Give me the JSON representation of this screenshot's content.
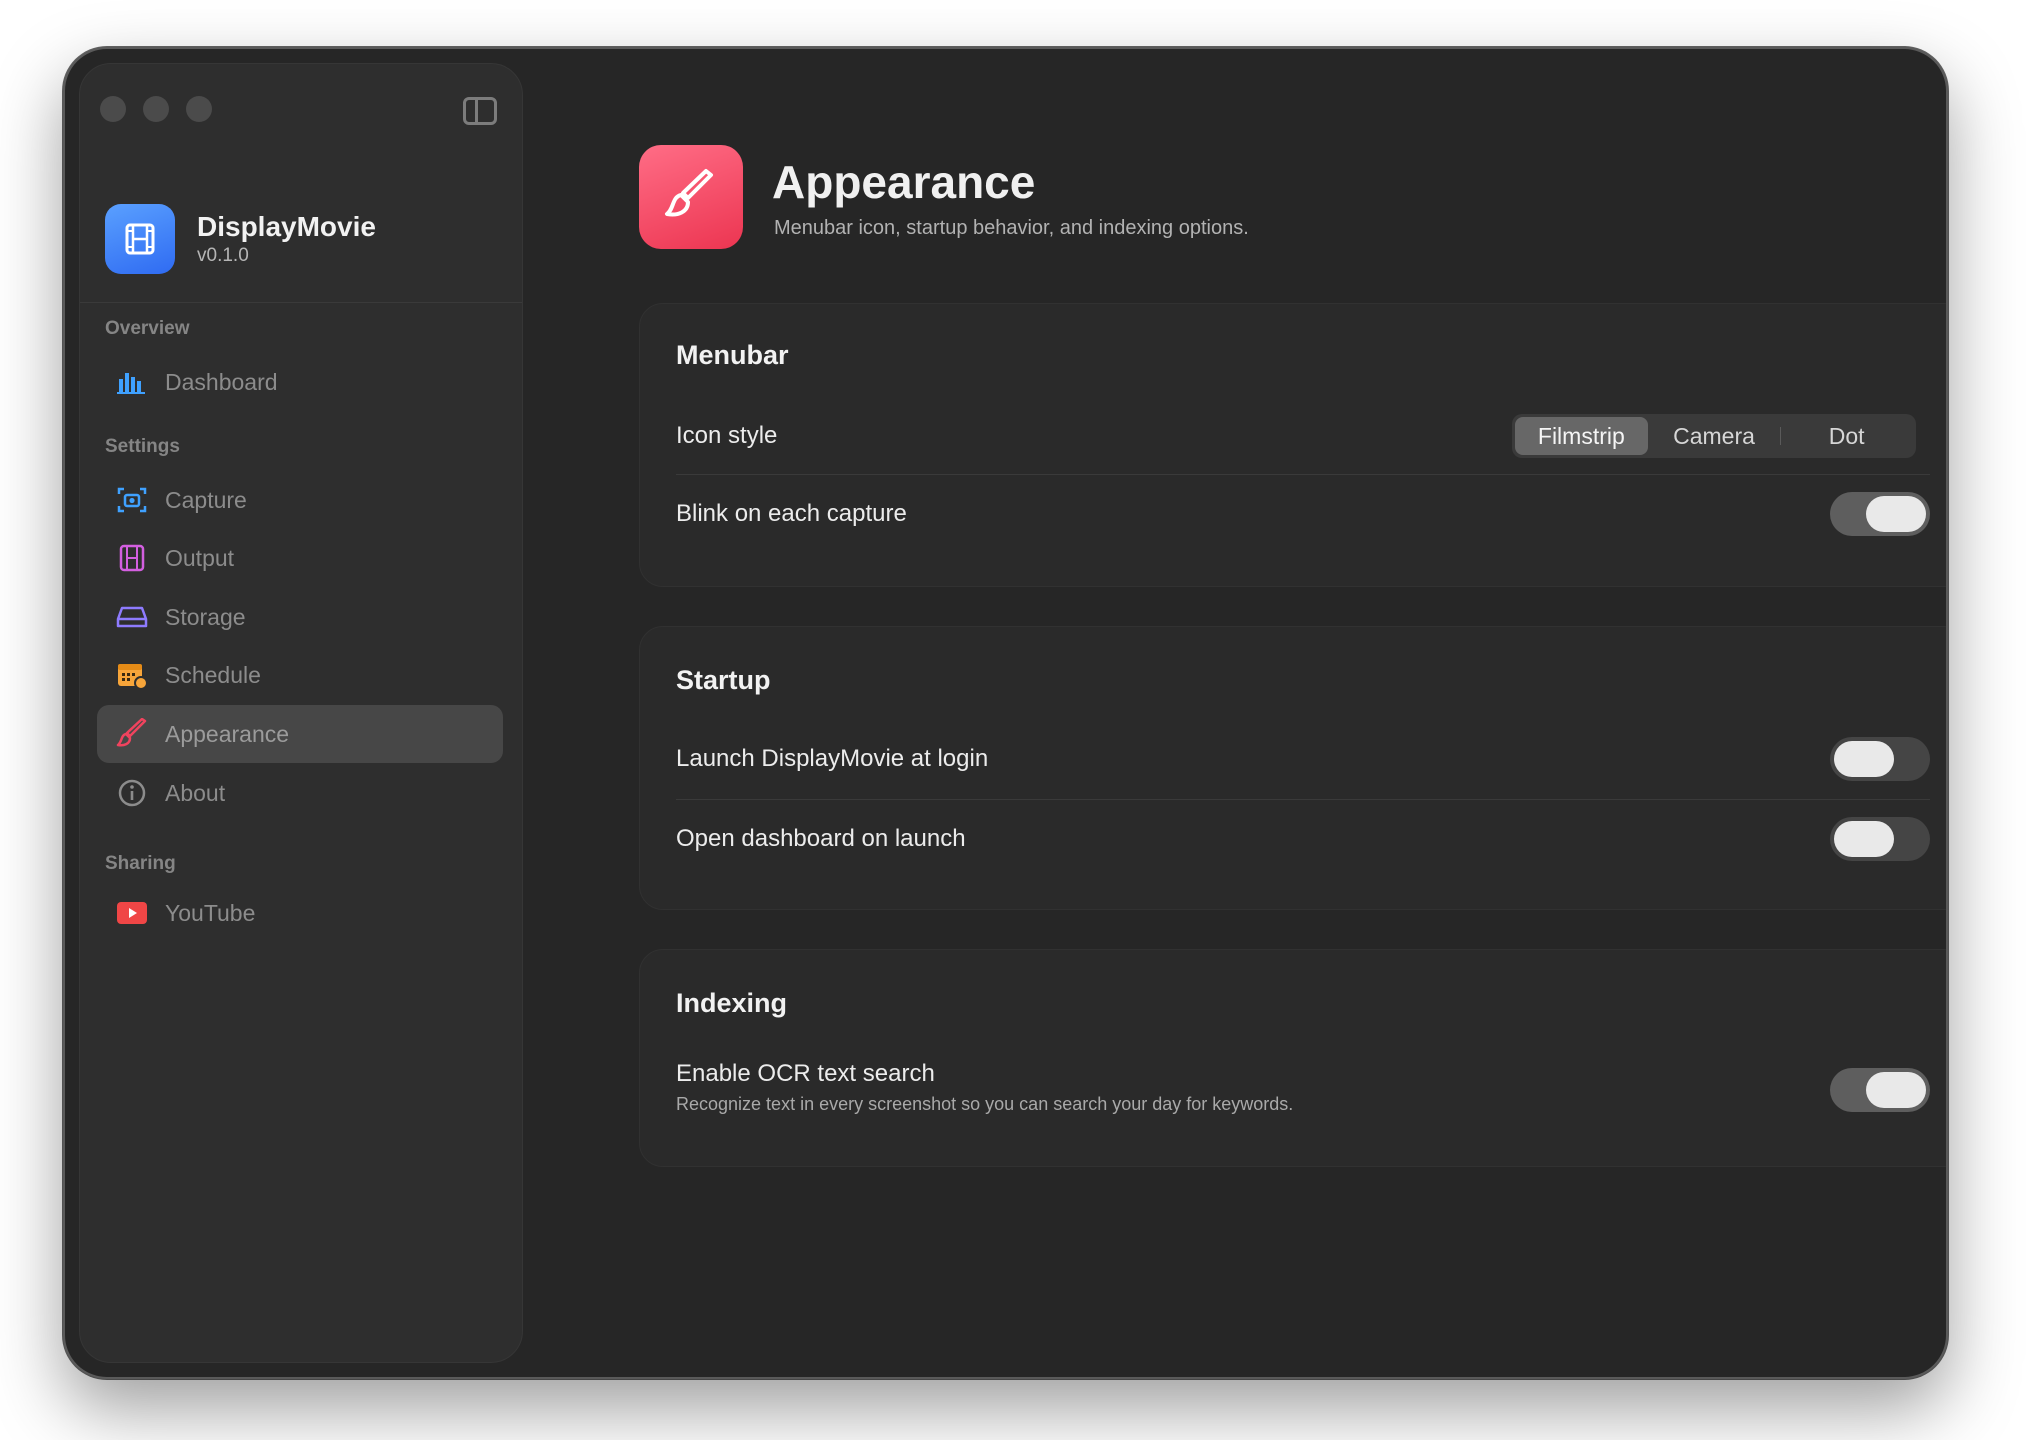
{
  "app": {
    "name": "DisplayMovie",
    "version": "v0.1.0"
  },
  "sidebar": {
    "sections": [
      {
        "label": "Overview",
        "items": [
          {
            "label": "Dashboard",
            "icon": "chart-bars-icon"
          }
        ]
      },
      {
        "label": "Settings",
        "items": [
          {
            "label": "Capture",
            "icon": "camera-viewfinder-icon"
          },
          {
            "label": "Output",
            "icon": "filmstrip-icon"
          },
          {
            "label": "Storage",
            "icon": "hard-drive-icon"
          },
          {
            "label": "Schedule",
            "icon": "calendar-clock-icon"
          },
          {
            "label": "Appearance",
            "icon": "paintbrush-icon",
            "active": true
          },
          {
            "label": "About",
            "icon": "info-circle-icon"
          }
        ]
      },
      {
        "label": "Sharing",
        "items": [
          {
            "label": "YouTube",
            "icon": "youtube-icon"
          }
        ]
      }
    ]
  },
  "page": {
    "title": "Appearance",
    "subtitle": "Menubar icon, startup behavior, and indexing options."
  },
  "menubar": {
    "title": "Menubar",
    "icon_style_label": "Icon style",
    "icon_style_options": [
      "Filmstrip",
      "Camera",
      "Dot"
    ],
    "icon_style_selected": "Filmstrip",
    "blink_label": "Blink on each capture",
    "blink_on": true
  },
  "startup": {
    "title": "Startup",
    "launch_label": "Launch DisplayMovie at login",
    "launch_on": false,
    "open_dashboard_label": "Open dashboard on launch",
    "open_dashboard_on": false
  },
  "indexing": {
    "title": "Indexing",
    "ocr_label": "Enable OCR text search",
    "ocr_desc": "Recognize text in every screenshot so you can search your day for keywords.",
    "ocr_on": true
  },
  "colors": {
    "window_bg": "#262626",
    "sidebar_bg": "#2e2e2e",
    "card_bg": "#2a2a2a",
    "app_icon_blue": "#3b7bf5",
    "appearance_pink": "#f0435e"
  }
}
